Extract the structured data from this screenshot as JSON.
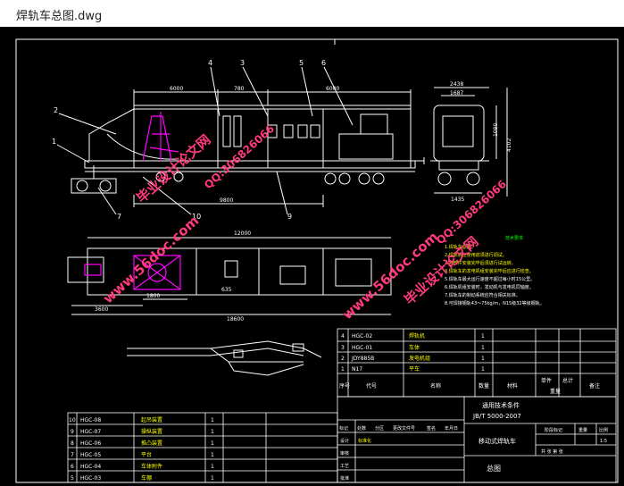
{
  "window": {
    "title": "焊轨车总图.dwg"
  },
  "colors": {
    "background": "#000000",
    "line": "#ffffff",
    "magenta": "#ff00ff",
    "watermark": "#ff3b7a",
    "green": "#00ff00",
    "yellow": "#ffff00",
    "cyan": "#00ffff"
  },
  "callouts": [
    "1",
    "2",
    "3",
    "4",
    "5",
    "6",
    "7",
    "8",
    "9",
    "10"
  ],
  "dimensions": {
    "side_top": [
      "6000",
      "780",
      "6000"
    ],
    "side_bottom": "9800",
    "end_top_outer": "2438",
    "end_top_inner": "1687",
    "end_right": "1080",
    "end_height": "4102",
    "end_bottom": "1435",
    "plan_total": "12000",
    "plan_bottom": "18600",
    "plan_left": "3600",
    "plan_inner": "1800",
    "plan_small": "635"
  },
  "notes": [
    "技术要求",
    "1.焊轨车总图。",
    "2.焊轨机在使用前须进行调试。",
    "3.各部件安装完毕后须进行试运转。",
    "4.焊轨车的发电机组安装完毕后应进行检查。",
    "5.焊轨车最大运行速度不超过每小时15公里。",
    "6.焊轨机组安装时，发动机与发电机同轴度。",
    "7.焊轨车的制动系统应符合相关标准。",
    "8.可焊接钢轨43～75kg/m，N15级32等级钢轨。"
  ],
  "bom_upper": [
    {
      "no": "4",
      "code": "HGC-02",
      "name": "焊轨机",
      "qty": "1"
    },
    {
      "no": "3",
      "code": "HGC-01",
      "name": "车体",
      "qty": "1"
    },
    {
      "no": "2",
      "code": "JDY885B",
      "name": "发电机组",
      "qty": "1"
    },
    {
      "no": "1",
      "code": "N17",
      "name": "平车",
      "qty": "1"
    }
  ],
  "bom_header": [
    "序号",
    "代号",
    "名称",
    "数量",
    "材料",
    "单件",
    "总计",
    "备注"
  ],
  "bom_header_sub": "重量",
  "bom_lower": [
    {
      "no": "10",
      "code": "HGC-08",
      "name": "起吊装置",
      "qty": "1"
    },
    {
      "no": "9",
      "code": "HGC-07",
      "name": "操纵装置",
      "qty": "1"
    },
    {
      "no": "8",
      "code": "HGC-06",
      "name": "推凸装置",
      "qty": "1"
    },
    {
      "no": "7",
      "code": "HGC-05",
      "name": "平台",
      "qty": "1"
    },
    {
      "no": "6",
      "code": "HGC-04",
      "name": "车体附件",
      "qty": "1"
    },
    {
      "no": "5",
      "code": "HGC-03",
      "name": "车棚",
      "qty": "1"
    }
  ],
  "title_block": {
    "spec1": "通用技术条件",
    "spec2": "JB/T 5000-2007",
    "product": "移动式焊轨车",
    "drawing": "总图",
    "stage": "阶段标记",
    "weight": "重量",
    "scale": "比例",
    "scale_value": "1:5",
    "sheets": "共  张  第  张",
    "rows": [
      "标记",
      "处数",
      "分区",
      "更改文件号",
      "签名",
      "年月日"
    ],
    "roles": [
      "设计",
      "审核",
      "工艺",
      "标准化",
      "批准"
    ],
    "standardize_note": "标准化"
  },
  "watermarks": [
    "毕业设计论文网",
    "QQ:306826066",
    "www.56doc.com"
  ]
}
